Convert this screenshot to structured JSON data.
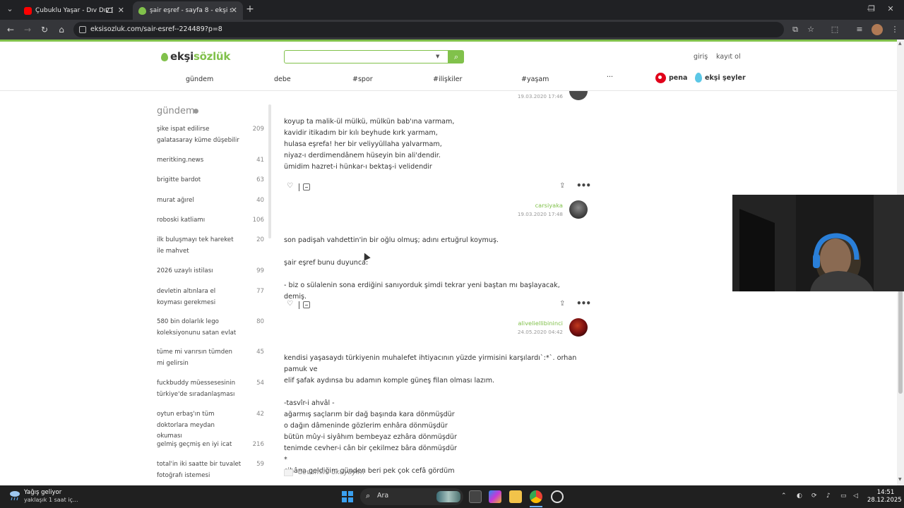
{
  "browser": {
    "tabs": [
      {
        "title": "Çubuklu Yaşar - Dıv Dıv [OF",
        "active": false
      },
      {
        "title": "şair eşref - sayfa 8 - ekşi sözlük",
        "active": true
      }
    ],
    "new_tab": "+",
    "url": "eksisozluk.com/sair-esref--224489?p=8",
    "window_controls": {
      "minimize": "—",
      "restore": "❐",
      "close": "✕"
    }
  },
  "site": {
    "logo": {
      "prefix": "ekşi",
      "suffix": "sözlük"
    },
    "search_placeholder": "",
    "login": "giriş",
    "register": "kayıt ol",
    "nav": [
      "gündem",
      "debe",
      "#spor",
      "#ilişkiler",
      "#yaşam",
      "···"
    ],
    "pena": "pena",
    "eksi_seyler": "ekşi şeyler",
    "brand_color": "#81c14b"
  },
  "sidebar": {
    "title": "gündem",
    "items": [
      {
        "title": "şike ispat edilirse galatasaray küme düşebilir",
        "count": "209"
      },
      {
        "title": "meritking.news",
        "count": "41"
      },
      {
        "title": "brigitte bardot",
        "count": "63"
      },
      {
        "title": "murat ağırel",
        "count": "40"
      },
      {
        "title": "roboski katliamı",
        "count": "106"
      },
      {
        "title": "ilk buluşmayı tek hareket ile mahvet",
        "count": "20"
      },
      {
        "title": "2026 uzaylı istilası",
        "count": "99"
      },
      {
        "title": "devletin altınlara el koyması gerekmesi",
        "count": "77"
      },
      {
        "title": "580 bin dolarlık lego koleksiyonunu satan evlat",
        "count": "80"
      },
      {
        "title": "tüme mi varırsın tümden mi gelirsin",
        "count": "45"
      },
      {
        "title": "fuckbuddy müessesesinin türkiye'de sıradanlaşması",
        "count": "54"
      },
      {
        "title": "oytun erbaş'ın tüm doktorlara meydan okuması",
        "count": "42"
      },
      {
        "title": "gelmiş geçmiş en iyi icat",
        "count": "216"
      },
      {
        "title": "total'in iki saatte bir tuvalet fotoğrafı istemesi",
        "count": "59"
      }
    ]
  },
  "entries": [
    {
      "date_above": "19.03.2020 17:46",
      "text": "koyup ta malik-ül mülkü, mülkün bab'ına varmam,\nkavidir itikadım bir kılı beyhude kırk yarmam,\nhulasa eşrefa! her bir veliyyüllaha yalvarmam,\nniyaz-ı derdimendânem hüseyin bin ali'dendir.\nümidim hazret-i hünkar-ı bektaş-i velidendir"
    },
    {
      "author": "carsiyaka",
      "date": "19.03.2020 17:48",
      "text": "son padişah vahdettin'in bir oğlu olmuş; adını ertuğrul koymuş.\n\nşair eşref bunu duyunca:\n\n- biz o sülalenin sona erdiğini sanıyorduk şimdi tekrar yeni baştan mı başlayacak, demiş."
    },
    {
      "author": "aliveliellibininci",
      "date": "24.05.2020 04:42",
      "text": "kendisi yaşasaydı türkiyenin muhalefet ihtiyacının yüzde yirmisini karşılardı`:*`. orhan pamuk ve\nelif şafak aydınsa bu adamın komple güneş filan olması lazım.\n\n-tasvîr-i ahvâl -\nağarmış saçlarım bir dağ başında kara dönmüşdür\no dağın dâmeninde gözlerim enhâra dönmüşdür\nbütün mûy-i siyâhım bembeyaz ezhâra dönmüşdür\ntenimde cevher-i cân bir çekilmez bâra dönmüşdür\n*\ncihâna geldiğim günden beri pek çok cefâ gördüm",
      "read_more": "devamını okuyayım"
    }
  ],
  "taskbar": {
    "weather_title": "Yağış geliyor",
    "weather_sub": "yaklaşık 1 saat iç...",
    "search": "Ara",
    "time": "14:51",
    "date": "28.12.2025"
  }
}
